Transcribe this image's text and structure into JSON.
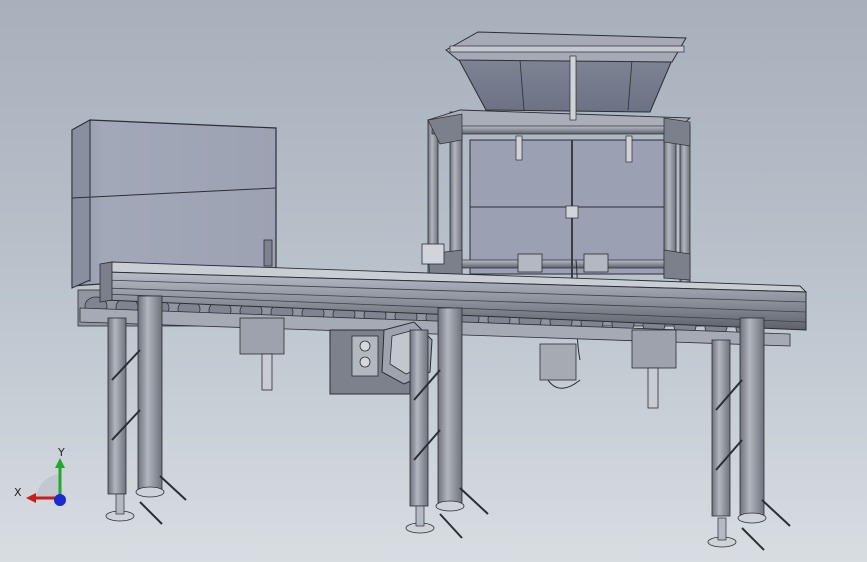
{
  "scene": {
    "background_top": "#a7b0bb",
    "background_bottom": "#d8dde2",
    "steel_color": "#8d929c",
    "steel_dark": "#4a4e57",
    "panel_color": "#9ea3b4",
    "outline_color": "#2b2e35"
  },
  "triad": {
    "x_label": "X",
    "y_label": "Y",
    "x_color": "#d11a1a",
    "y_color": "#22a82a",
    "z_color": "#1a2bd1"
  }
}
